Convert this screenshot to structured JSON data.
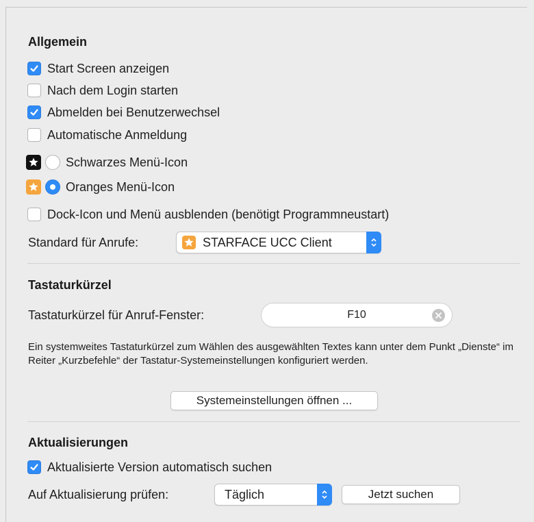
{
  "allgemein": {
    "title": "Allgemein",
    "options": {
      "start_screen": {
        "label": "Start Screen anzeigen",
        "checked": true
      },
      "after_login": {
        "label": "Nach dem Login starten",
        "checked": false
      },
      "logout_user_switch": {
        "label": "Abmelden bei Benutzerwechsel",
        "checked": true
      },
      "auto_login": {
        "label": "Automatische Anmeldung",
        "checked": false
      }
    },
    "menu_icons": {
      "black": {
        "label": "Schwarzes Menü-Icon",
        "selected": false,
        "icon": "star-icon",
        "color": "#111111"
      },
      "orange": {
        "label": "Oranges Menü-Icon",
        "selected": true,
        "icon": "star-icon",
        "color": "#f5a53d"
      }
    },
    "hide_dock": {
      "label": "Dock-Icon und Menü ausblenden (benötigt Programmneustart)",
      "checked": false
    },
    "default_calls": {
      "label": "Standard für Anrufe:",
      "value": "STARFACE UCC Client",
      "icon": "starface-app-icon"
    }
  },
  "tastatur": {
    "title": "Tastaturkürzel",
    "shortcut_label": "Tastaturkürzel für Anruf-Fenster:",
    "shortcut_value": "F10",
    "description": "Ein systemweites Tastaturkürzel zum Wählen des ausgewählten Textes kann unter dem Punkt „Dienste“ im Reiter „Kurzbefehle“ der Tastatur-Systemeinstellungen konfiguriert werden.",
    "open_settings_button": "Systemeinstellungen öffnen ..."
  },
  "updates": {
    "title": "Aktualisierungen",
    "auto_check": {
      "label": "Aktualisierte Version automatisch suchen",
      "checked": true
    },
    "check_label": "Auf Aktualisierung prüfen:",
    "interval_value": "Täglich",
    "search_now_button": "Jetzt suchen"
  },
  "colors": {
    "accent": "#2f8bf5",
    "orange_icon": "#f5a53d",
    "background": "#ececec"
  }
}
